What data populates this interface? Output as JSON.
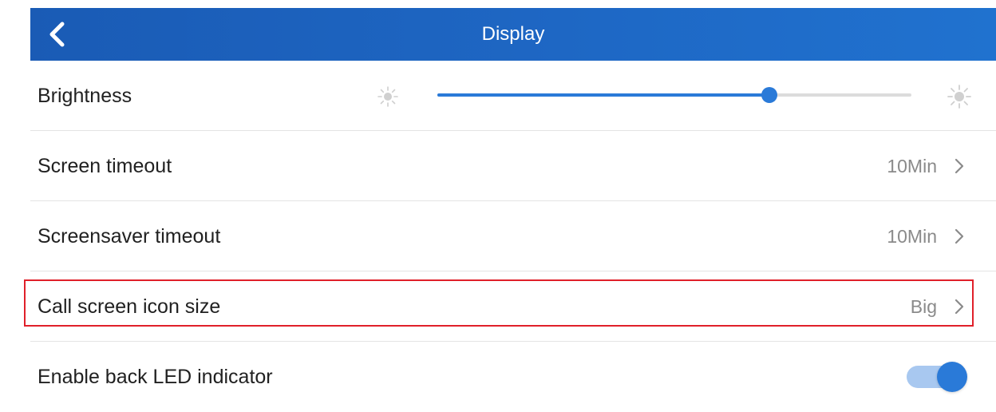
{
  "header": {
    "title": "Display",
    "back_icon": "chevron-left-icon"
  },
  "brightness": {
    "label": "Brightness",
    "level": 0.7,
    "low_icon": "sun-small-icon",
    "high_icon": "sun-large-icon"
  },
  "rows": [
    {
      "label": "Screen timeout",
      "value": "10Min"
    },
    {
      "label": "Screensaver timeout",
      "value": "10Min"
    },
    {
      "label": "Call screen icon size",
      "value": "Big",
      "highlighted": true
    }
  ],
  "back_led": {
    "label": "Enable back LED indicator",
    "enabled": true
  },
  "colors": {
    "header": "#1e67c4",
    "accent": "#2a7ad8",
    "highlight": "#e0202a"
  }
}
